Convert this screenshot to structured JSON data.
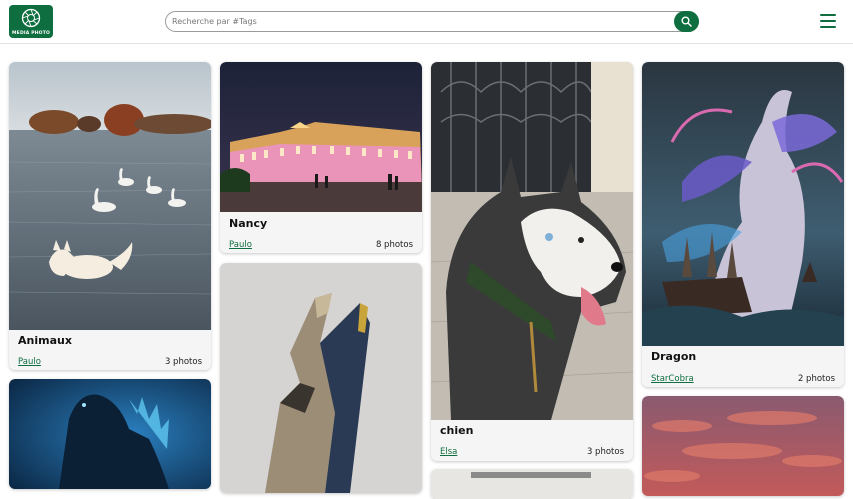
{
  "header": {
    "logo_text": "MEDIA PHOTO",
    "search_placeholder": "Recherche par #Tags",
    "search_icon": "search-icon",
    "menu_icon": "hamburger-menu-icon"
  },
  "colors": {
    "brand_green": "#0e6e3f",
    "card_bg": "#f5f5f5"
  },
  "albums": [
    {
      "title": "Animaux",
      "user": "Paulo",
      "count": "3 photos"
    },
    {
      "title": "Nancy",
      "user": "Paulo",
      "count": "8 photos"
    },
    {
      "title": "chien",
      "user": "Elsa",
      "count": "3 photos"
    },
    {
      "title": "Dragon",
      "user": "StarCobra",
      "count": "2 photos"
    }
  ]
}
